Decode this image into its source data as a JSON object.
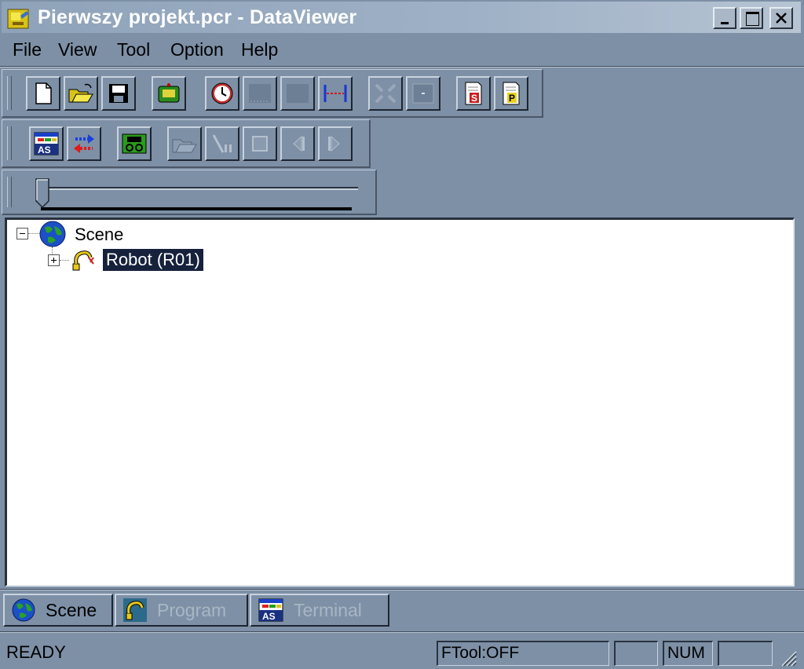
{
  "window": {
    "title": "Pierwszy projekt.pcr - DataViewer",
    "buttons": [
      "minimize",
      "maximize",
      "close"
    ]
  },
  "menu": [
    "File",
    "View",
    "Tool",
    "Option",
    "Help"
  ],
  "toolbar1": {
    "buttons": [
      "new-file-icon",
      "open-folder-icon",
      "save-disk-icon",
      "pendant-icon",
      "clock-icon",
      "blank-icon",
      "blank-icon",
      "measure-icon",
      "settings-icon",
      "minus-icon",
      "s-document-icon",
      "p-document-icon"
    ]
  },
  "toolbar2": {
    "buttons": [
      "as-terminal-icon",
      "transfer-arrows-icon",
      "tape-record-icon",
      "open-folder-icon",
      "play-pause-icon",
      "stop-icon",
      "step-back-icon",
      "step-forward-icon"
    ]
  },
  "slider": {
    "value": 0
  },
  "tree": {
    "root": {
      "label": "Scene",
      "icon": "globe-icon",
      "expanded": true
    },
    "children": [
      {
        "label": "Robot (R01)",
        "icon": "robot-icon",
        "expanded": false,
        "selected": true
      }
    ]
  },
  "tabs": [
    {
      "label": "Scene",
      "icon": "globe-icon",
      "active": true
    },
    {
      "label": "Program",
      "icon": "robot-icon",
      "active": false
    },
    {
      "label": "Terminal",
      "icon": "as-terminal-icon",
      "active": false
    }
  ],
  "status": {
    "text": "READY",
    "ftool": "FTool:OFF",
    "blank": "",
    "num": "NUM",
    "blank2": ""
  },
  "colors": {
    "window_bg": "#7d90a6",
    "title_gradient_start": "#8ea2b9",
    "selection": "#16213c",
    "tree_bg": "#ffffff"
  }
}
